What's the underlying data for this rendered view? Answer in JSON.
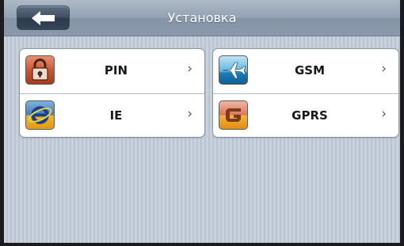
{
  "header": {
    "title": "Установка",
    "back_icon": "back-arrow-icon"
  },
  "panels": {
    "left": [
      {
        "label": "PIN",
        "icon": "padlock-icon",
        "chevron": "›"
      },
      {
        "label": "IE",
        "icon": "internet-explorer-icon",
        "chevron": "›"
      }
    ],
    "right": [
      {
        "label": "GSM",
        "icon": "airplane-icon",
        "chevron": "›"
      },
      {
        "label": "GPRS",
        "icon": "gprs-g-icon",
        "chevron": "›"
      }
    ]
  },
  "colors": {
    "header": "#8a99ab",
    "background": "#c4ccd8",
    "panel": "#ffffff",
    "text": "#1a1a1a"
  }
}
